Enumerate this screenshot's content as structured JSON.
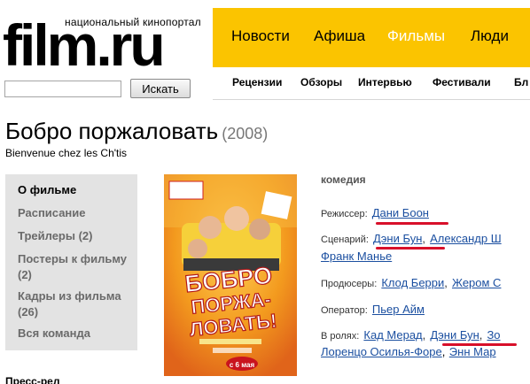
{
  "header": {
    "logo_text": "film.ru",
    "tagline": "национальный кинопортал",
    "top_nav": [
      {
        "label": "Новости",
        "active": false
      },
      {
        "label": "Афиша",
        "active": false
      },
      {
        "label": "Фильмы",
        "active": true
      },
      {
        "label": "Люди",
        "active": false
      }
    ],
    "sub_nav": [
      "Рецензии",
      "Обзоры",
      "Интервью",
      "Фестивали",
      "Бл"
    ],
    "search": {
      "value": "",
      "button": "Искать"
    }
  },
  "film": {
    "title": "Бобро поржаловать",
    "year": "(2008)",
    "original_title": "Bienvenue chez les Ch'tis",
    "genre": "комедия",
    "director_label": "Режиссер:",
    "director": "Дани Боон",
    "writers_label": "Сценарий:",
    "writers": [
      "Дэни Бун",
      "Александр Ш",
      "Франк Манье"
    ],
    "producers_label": "Продюсеры:",
    "producers": [
      "Клод Берри",
      "Жером С"
    ],
    "operator_label": "Оператор:",
    "operator": "Пьер Айм",
    "cast_label": "В ролях:",
    "cast": [
      "Кад Мерад",
      "Дэни Бун",
      "Зо",
      "Лоренцо Осилья-Форе",
      "Энн Мар"
    ]
  },
  "sidebar": {
    "items": [
      {
        "label": "О фильме",
        "active": true
      },
      {
        "label": "Расписание",
        "active": false
      },
      {
        "label": "Трейлеры (2)",
        "active": false
      },
      {
        "label": "Постеры к фильму (2)",
        "active": false
      },
      {
        "label": "Кадры из фильма (26)",
        "active": false
      },
      {
        "label": "Вся команда",
        "active": false
      }
    ]
  },
  "poster": {
    "title_text": "БОБРО ПОРЖА-ЛОВАТЬ!",
    "date": "с 6 мая"
  },
  "below": {
    "cutoff_text": "Пресс-рел"
  },
  "colors": {
    "nav_yellow": "#fbc400",
    "link_blue": "#1b4fa0",
    "annotation_red": "#d8102a",
    "menu_bg": "#e3e3e3"
  }
}
